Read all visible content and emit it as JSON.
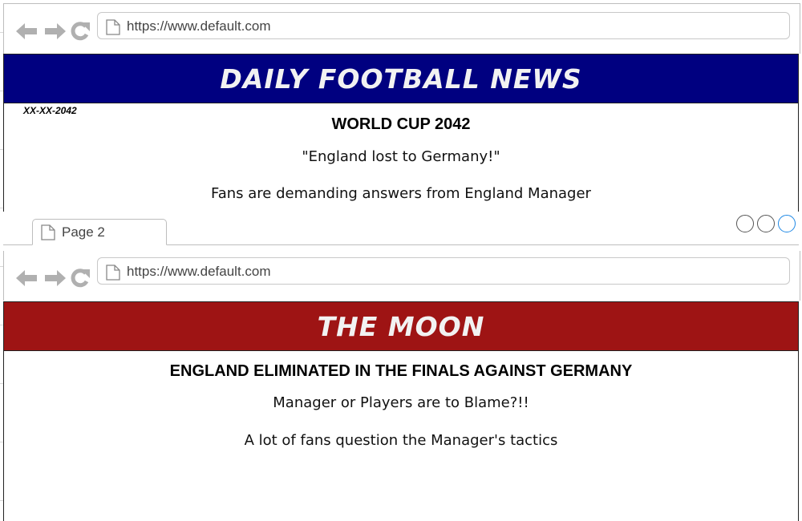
{
  "browser1": {
    "url": "https://www.default.com",
    "banner_title": "DAILY FOOTBALL NEWS",
    "banner_color": "#000080",
    "date": "XX-XX-2042",
    "headline": "WORLD CUP 2042",
    "quote": "\"England lost to Germany!\"",
    "body": "Fans are demanding answers from England Manager"
  },
  "tab": {
    "label": "Page 2"
  },
  "browser2": {
    "url": "https://www.default.com",
    "banner_title": "THE MOON",
    "banner_color": "#9e1414",
    "headline": "ENGLAND ELIMINATED IN THE FINALS AGAINST GERMANY",
    "subline": "Manager or Players are to Blame?!!",
    "body": "A lot of fans question the Manager's tactics"
  },
  "icons": {
    "back": "arrow-left-icon",
    "forward": "arrow-right-icon",
    "reload": "reload-icon",
    "page": "document-icon",
    "window_controls": [
      "circle-icon",
      "circle-icon",
      "circle-icon"
    ]
  },
  "colors": {
    "icon_gray": "#b0b0b0",
    "window_control_active": "#1e88e5"
  }
}
